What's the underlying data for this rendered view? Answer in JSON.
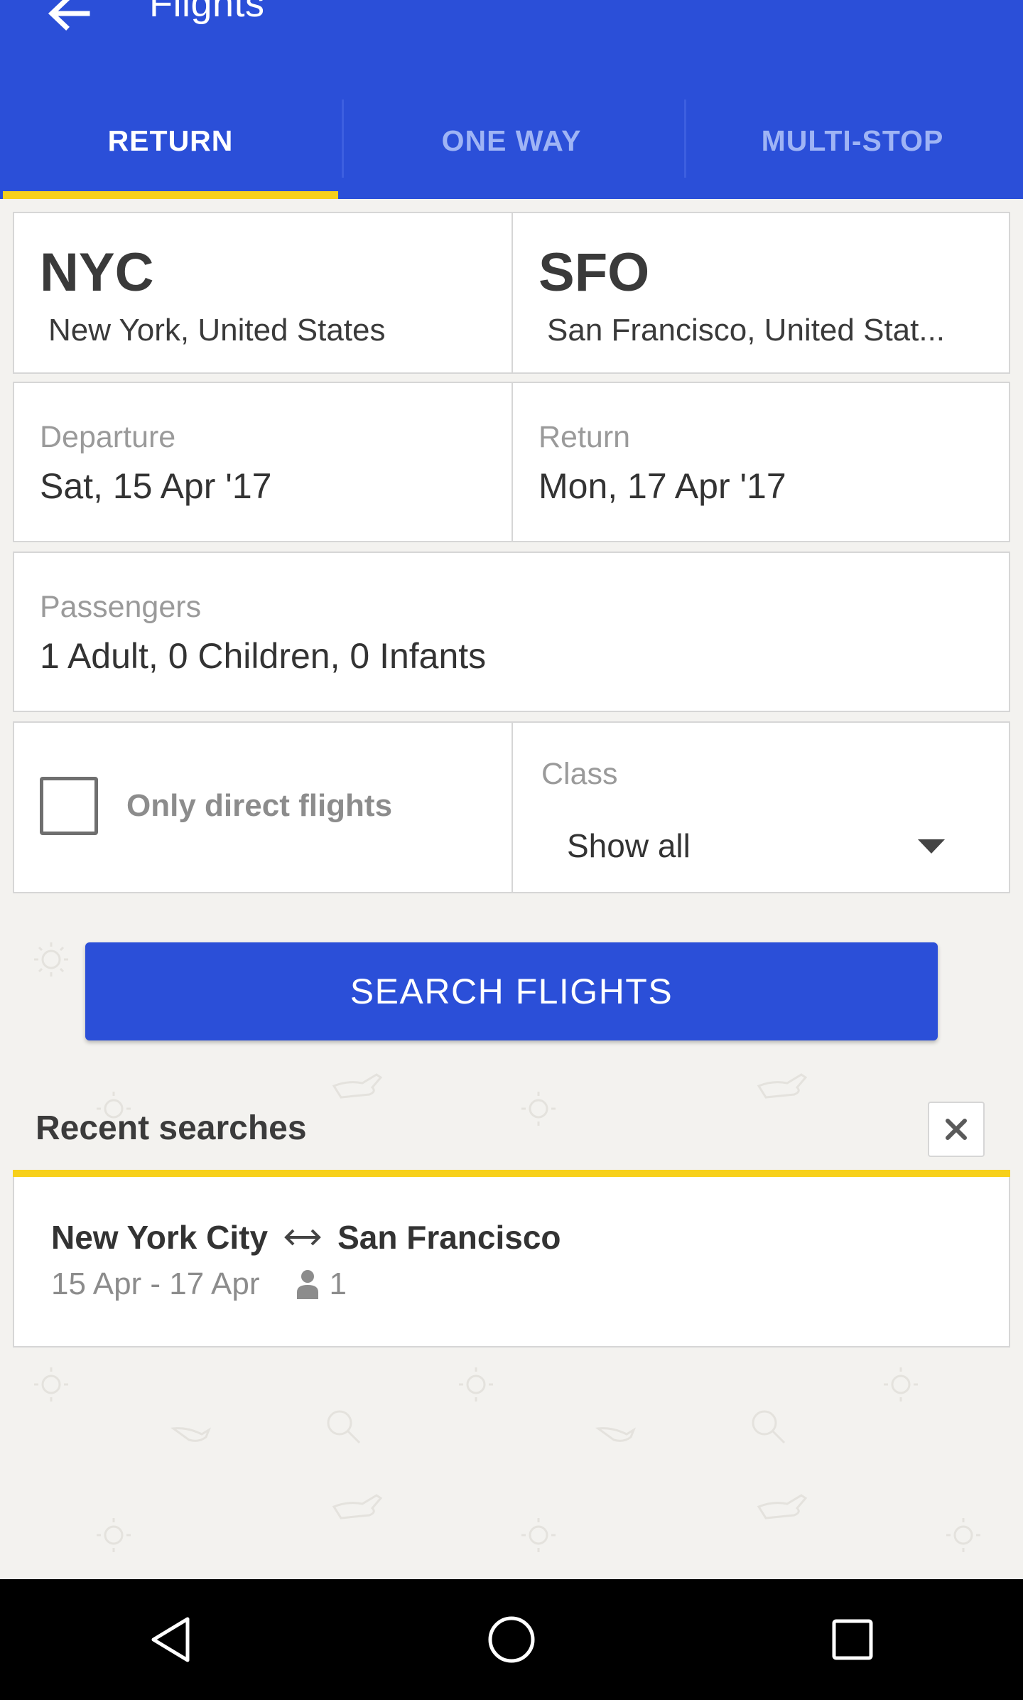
{
  "header": {
    "title": "Flights",
    "back_icon": "arrow-left-icon",
    "background_color": "#2b4fd8",
    "accent_color": "#f7d01b"
  },
  "tabs": [
    {
      "label": "RETURN",
      "active": true
    },
    {
      "label": "ONE WAY",
      "active": false
    },
    {
      "label": "MULTI-STOP",
      "active": false
    }
  ],
  "route": {
    "origin": {
      "code": "NYC",
      "city": "New York, United States"
    },
    "destination": {
      "code": "SFO",
      "city": "San Francisco, United Stat..."
    }
  },
  "dates": {
    "departure_label": "Departure",
    "departure_value": "Sat, 15 Apr '17",
    "return_label": "Return",
    "return_value": "Mon, 17 Apr '17"
  },
  "passengers": {
    "label": "Passengers",
    "value": "1 Adult, 0 Children, 0 Infants"
  },
  "options": {
    "direct_label": "Only direct flights",
    "direct_checked": false,
    "class_label": "Class",
    "class_value": "Show all"
  },
  "search_button": {
    "label": "SEARCH FLIGHTS"
  },
  "recent": {
    "title": "Recent searches",
    "clear_icon": "close-icon",
    "items": [
      {
        "from": "New York City",
        "to": "San Francisco",
        "route_icon": "swap-arrows-icon",
        "dates": "15 Apr - 17 Apr",
        "person_icon": "person-icon",
        "passengers": "1"
      }
    ]
  },
  "system_nav": {
    "back_icon": "triangle-back-icon",
    "home_icon": "circle-home-icon",
    "recents_icon": "square-recents-icon"
  }
}
